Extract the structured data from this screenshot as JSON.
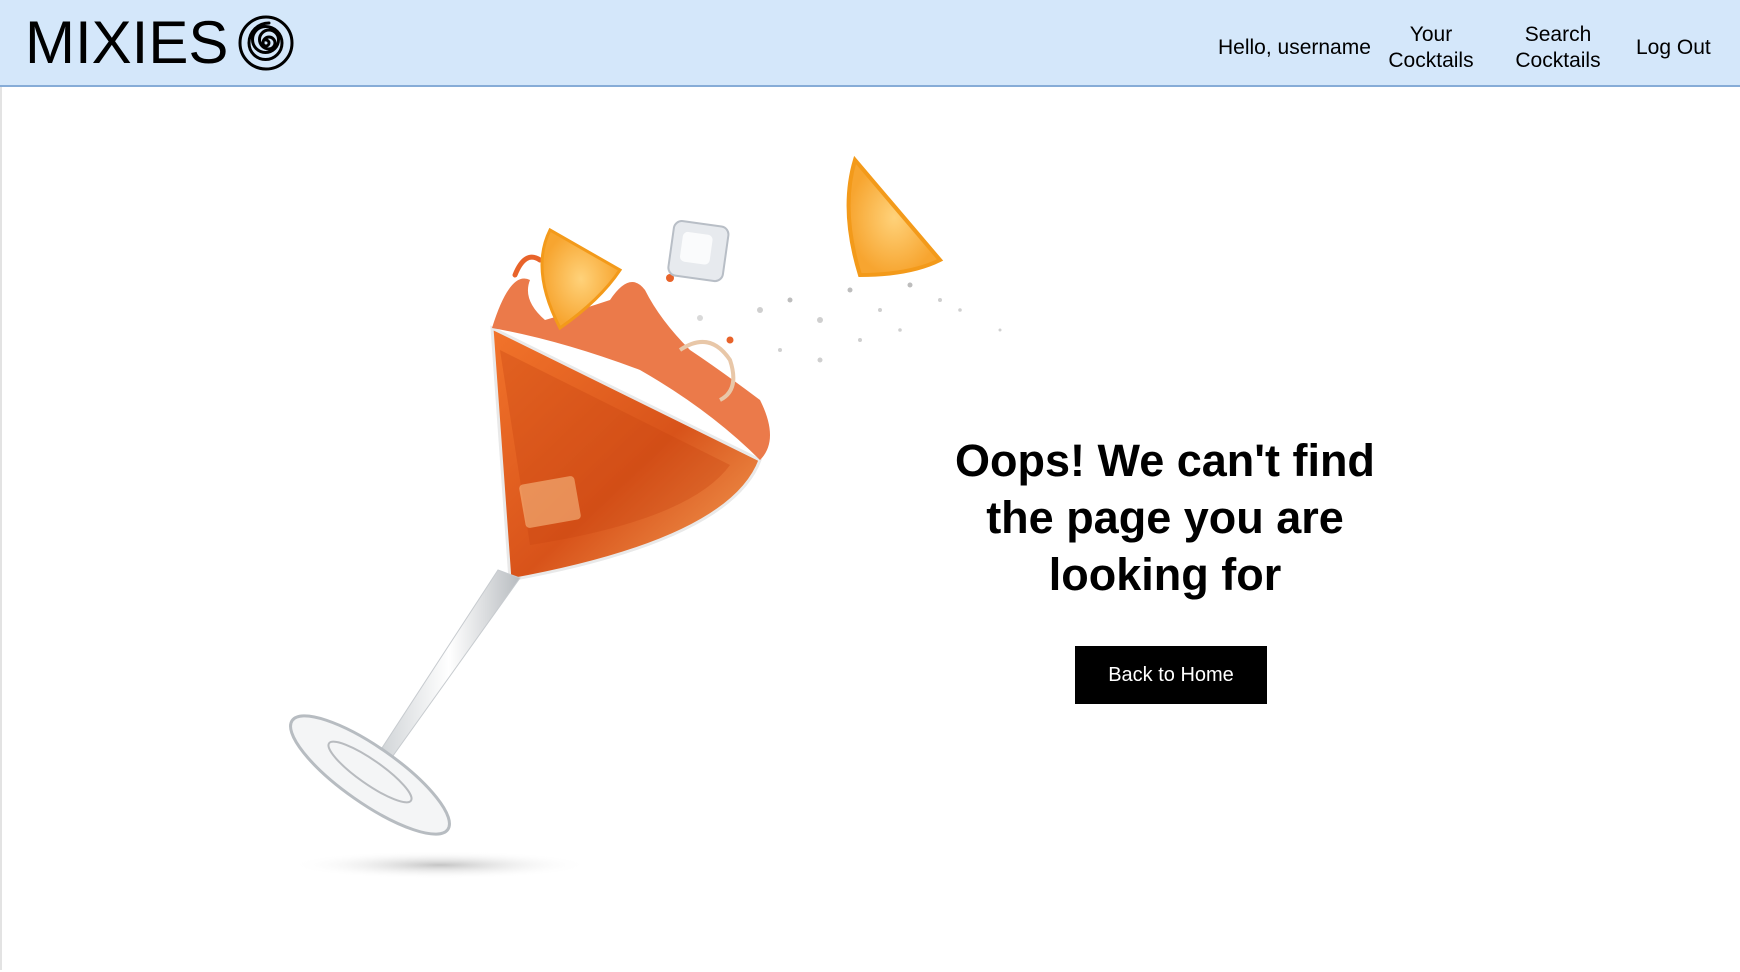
{
  "header": {
    "brand": "MIXIES",
    "brand_icon": "spiral-icon",
    "background_color": "#d4e7fa",
    "greeting": "Hello, username",
    "nav": {
      "your_cocktails": "Your Cocktails",
      "search_cocktails": "Search Cocktails",
      "log_out": "Log Out"
    }
  },
  "main": {
    "illustration": "cocktail-glass-splash-image",
    "message": "Oops! We can't find the page you are looking for",
    "back_button": "Back to Home",
    "button_color": "#000000"
  }
}
